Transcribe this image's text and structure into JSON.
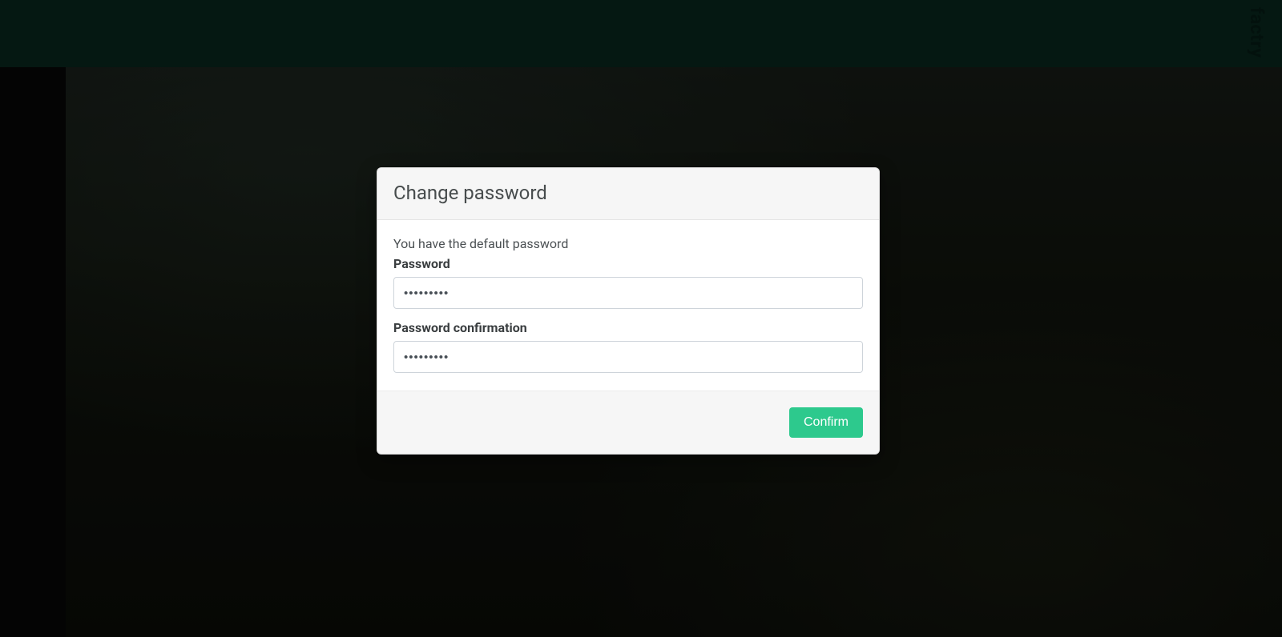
{
  "header": {
    "brand": "factry"
  },
  "modal": {
    "title": "Change password",
    "subtext": "You have the default password",
    "password_label": "Password",
    "password_value": "•••••••••",
    "confirmation_label": "Password confirmation",
    "confirmation_value": "•••••••••",
    "confirm_button": "Confirm"
  }
}
